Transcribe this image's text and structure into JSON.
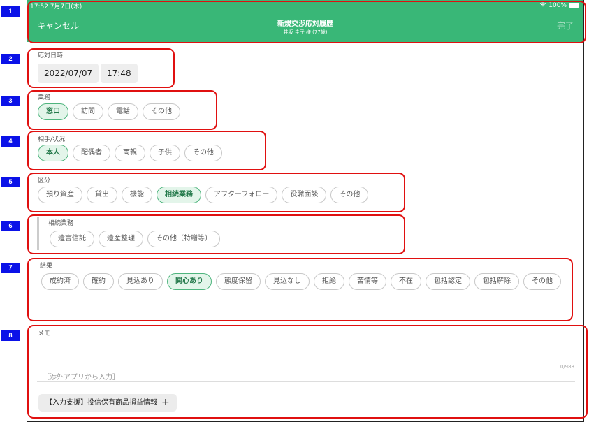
{
  "status": {
    "time": "17:52  7月7日(木)",
    "right": "100%"
  },
  "header": {
    "cancel": "キャンセル",
    "title": "新規交渉応対履歴",
    "subtitle": "井坂 圭子 様 (77歳)",
    "done": "完了"
  },
  "datetime": {
    "label": "応対日時",
    "date": "2022/07/07",
    "time": "17:48"
  },
  "gyomu": {
    "label": "業務",
    "options": [
      "窓口",
      "訪問",
      "電話",
      "その他"
    ],
    "selected": "窓口"
  },
  "aite": {
    "label": "相手/状況",
    "options": [
      "本人",
      "配偶者",
      "両親",
      "子供",
      "その他"
    ],
    "selected": "本人"
  },
  "kubun": {
    "label": "区分",
    "options": [
      "預り資産",
      "貸出",
      "機能",
      "相続業務",
      "アフターフォロー",
      "役職面談",
      "その他"
    ],
    "selected": "相続業務"
  },
  "souzoku": {
    "label": "相続業務",
    "options": [
      "遺言信託",
      "遺産整理",
      "その他（特贈等）"
    ]
  },
  "kekka": {
    "label": "結果",
    "options": [
      "成約済",
      "確約",
      "見込あり",
      "関心あり",
      "態度保留",
      "見込なし",
      "拒絶",
      "苦情等",
      "不在",
      "包括認定",
      "包括解除",
      "その他"
    ],
    "selected": "関心あり"
  },
  "memo": {
    "label": "メモ",
    "count": "0/988",
    "placeholder": "［渉外アプリから入力］",
    "assist_button": "【入力支援】投信保有商品損益情報",
    "assist_icon": "plus-icon"
  },
  "annotations": [
    "1",
    "2",
    "3",
    "4",
    "5",
    "6",
    "7",
    "8"
  ],
  "colors": {
    "header": "#39b777",
    "selected_bg": "#e3f5ea",
    "selected_border": "#4fb57e",
    "annotation_tag": "#0b12e8",
    "annotation_box": "#e01010"
  }
}
